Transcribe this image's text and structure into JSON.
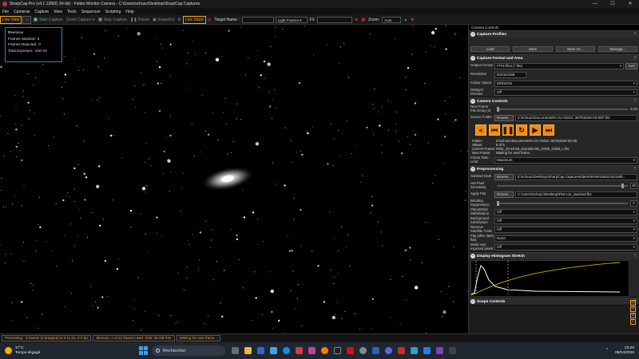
{
  "window": {
    "title": "SharpCap Pro (v4.1.12660, 64 bit) - Folder Monitor Camera - C:\\Users\\schusc\\Desktop\\SharpCap Captures",
    "minimize": "—",
    "maximize": "☐",
    "close": "✕"
  },
  "menu": [
    "File",
    "Cameras",
    "Capture",
    "View",
    "Tools",
    "Sequencer",
    "Scripting",
    "Help"
  ],
  "toolbar": {
    "live_view": "Live View",
    "start_capture": "Start Capture",
    "quick_capture": "Quick Capture",
    "stop_capture": "Stop Capture",
    "pause": "Pause",
    "snapshot": "Snapshot",
    "live_stack": "Live Stack",
    "target_name": "Target Name :",
    "light_frames": "Light Frames",
    "fx": "FX",
    "zoom": "Zoom:",
    "zoom_value": "Auto"
  },
  "overview": {
    "title": "Overview",
    "frames_stacked_label": "Frames Stacked:",
    "frames_stacked": "5",
    "frames_rejected_label": "Frames Rejected:",
    "frames_rejected": "0",
    "total_exposure_label": "Total Exposure:",
    "total_exposure": "15m 0s"
  },
  "panel": {
    "title": "Camera Controls",
    "profiles": {
      "title": "Capture Profiles",
      "load": "Load",
      "save": "Save",
      "save_as": "Save As...",
      "manage": "Manage..."
    },
    "format": {
      "title": "Capture Format and Area",
      "output_format_label": "Output Format",
      "output_format": "FITS files (*.fits)",
      "auto": "Auto",
      "resolution_label": "Resolution",
      "resolution": "6224x4168",
      "colour_space_label": "Colour Space",
      "colour_space": "MONO16",
      "debayer_label": "Debayer Preview",
      "debayer": "Off"
    },
    "camera": {
      "title": "Camera Controls",
      "delay_label": "New Frame File Delay (s)",
      "delay": "5.00",
      "source_label": "Source Folder",
      "browse": "Browse...",
      "source": "Z:\\schusc\\Documents\\N.I.N.A\\NGC 3675\\2026-04-08\\*.fits",
      "folder_label": "Folder:",
      "folder": "Z:\\schusc\\Documents\\N.I.N.A\\NGC 3675\\2026-04-08",
      "status_label": "Status:",
      "status": "5 of 5",
      "current_label": "Current Frame:",
      "current": "0004_23-16-55_Exp180.00s_G300_O300_L.fits",
      "next_label": "Next Frame:",
      "next": "Waiting for next frame...",
      "rate_label": "Frame Rate Limit",
      "rate": "Maximum"
    },
    "pre": {
      "title": "Preprocessing",
      "dark_label": "Subtract Dark",
      "browse": "Browse...",
      "dark": "Z:\\schusc\\Desktop\\SharpCap Captures\\darks\\RAW16\\6224x4168\\...",
      "hot_label": "Hot Pixel Sensitivity",
      "hot": "25",
      "flat_label": "Apply Flat",
      "flat": "C:\\Users\\schusc\\Desktop\\Flat-c11_stacked.fits",
      "banding_label": "Banding Suppression",
      "banding": "0",
      "planet_label": "Planet/Disk Stabilization",
      "planet": "Off",
      "bg_label": "Background Subtraction",
      "bg": "Off",
      "sat_label": "Remove Satellite Trails",
      "sat": "Off",
      "flip_label": "Flip (after dark) flat)",
      "flip": "None",
      "mask_label": "Mask over exposed pixels",
      "mask": "Off"
    },
    "hist": {
      "title": "Display Histogram Stretch"
    },
    "scope": {
      "title": "Scope Controls"
    }
  },
  "status": {
    "previewing": "Previewing : 5 frames (0 dropped) in 0:11:21, 0.0 fps",
    "memory": "Memory: 4 of 41 frames used. Disk: 38 GB free",
    "waiting": "Waiting for next frame..."
  },
  "taskbar": {
    "temp": "17°C",
    "weather": "Temps dégagé",
    "search": "Rechercher",
    "time": "23:20",
    "date": "08/04/2026"
  }
}
